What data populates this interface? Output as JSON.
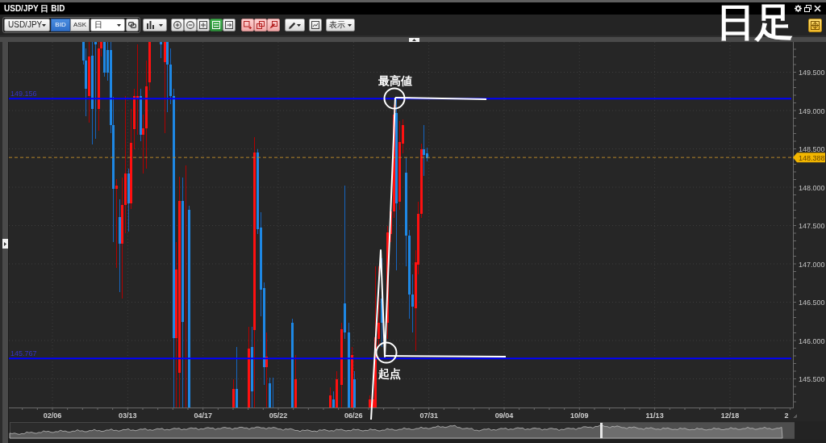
{
  "window": {
    "title": "USD/JPY 日 BID"
  },
  "overlay_caption": "日足",
  "toolbar": {
    "symbol": "USD/JPY",
    "price_sides": [
      {
        "label": "BID",
        "selected": true
      },
      {
        "label": "ASK",
        "selected": false
      }
    ],
    "timeframe": "日",
    "view_buttons": [
      {
        "on": false
      },
      {
        "on": false
      },
      {
        "on": false
      },
      {
        "on": true
      },
      {
        "on": false
      }
    ],
    "display_menu": "表示"
  },
  "chart": {
    "price_labels": [
      "149.500",
      "149.000",
      "148.500",
      "148.000",
      "147.500",
      "147.000",
      "146.500",
      "146.000",
      "145.500"
    ],
    "current_price": "148.388",
    "level_lines": [
      {
        "label": "149.156"
      },
      {
        "label": "145.767"
      }
    ],
    "date_labels": [
      "02/06",
      "03/13",
      "04/17",
      "05/22",
      "06/26",
      "07/31",
      "09/04",
      "10/09",
      "11/13",
      "12/18",
      "2"
    ],
    "annotations": [
      {
        "kind": "high",
        "label": "最高値"
      },
      {
        "kind": "start",
        "label": "起点"
      }
    ]
  }
}
